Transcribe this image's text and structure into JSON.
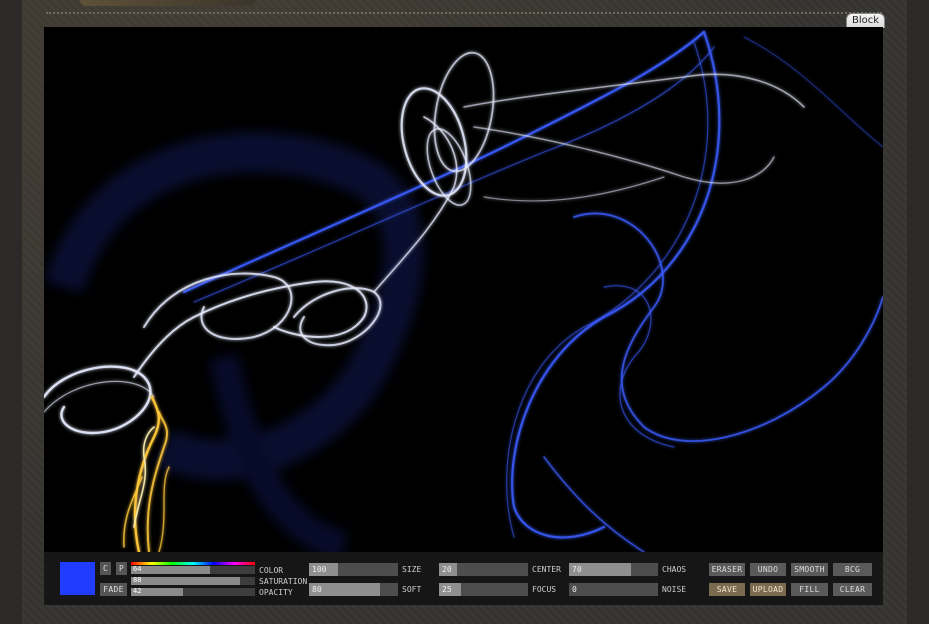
{
  "header": {
    "block_label": "Block"
  },
  "brush": {
    "color": "#1f3cff"
  },
  "buttons": {
    "c": "C",
    "p": "P",
    "fade": "FADE",
    "eraser": "ERASER",
    "undo": "UNDO",
    "smooth": "SMOOTH",
    "bcg": "BCG",
    "save": "SAVE",
    "upload": "UPLOAD",
    "fill": "FILL",
    "clear": "CLEAR"
  },
  "color_controls": {
    "color": {
      "label": "COLOR",
      "value": "64",
      "fraction": 0.64
    },
    "saturation": {
      "label": "SATURATION",
      "value": "88",
      "fraction": 0.88
    },
    "opacity": {
      "label": "OPACITY",
      "value": "42",
      "fraction": 0.42
    }
  },
  "sliders": {
    "size": {
      "label": "SIZE",
      "value": "100",
      "fraction": 0.33
    },
    "soft": {
      "label": "SOFT",
      "value": "80",
      "fraction": 0.8
    },
    "center": {
      "label": "CENTER",
      "value": "20",
      "fraction": 0.2
    },
    "focus": {
      "label": "FOCUS",
      "value": "25",
      "fraction": 0.25
    },
    "chaos": {
      "label": "CHAOS",
      "value": "70",
      "fraction": 0.7
    },
    "noise": {
      "label": "NOISE",
      "value": "0",
      "fraction": 0.0
    }
  }
}
